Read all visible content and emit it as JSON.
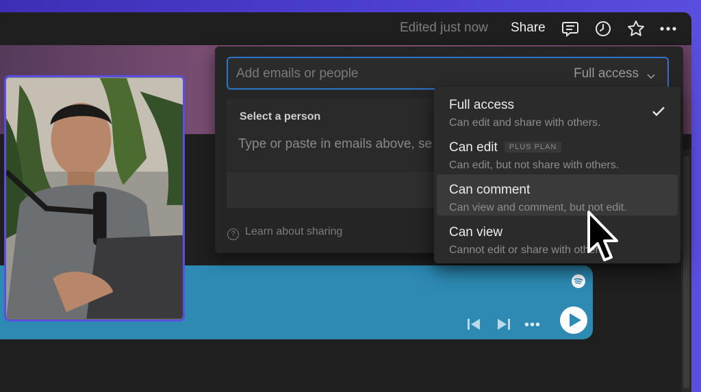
{
  "topbar": {
    "edited": "Edited just now",
    "share": "Share",
    "icons": [
      "comment-icon",
      "clock-icon",
      "star-icon",
      "more-icon"
    ]
  },
  "share_panel": {
    "email_placeholder": "Add emails or people",
    "access_value": "Full access",
    "select_title": "Select a person",
    "select_hint": "Type or paste in emails above, se",
    "learn": "Learn about sharing"
  },
  "access_menu": {
    "options": [
      {
        "title": "Full access",
        "desc": "Can edit and share with others.",
        "selected": true
      },
      {
        "title": "Can edit",
        "badge": "PLUS PLAN",
        "desc": "Can edit, but not share with others."
      },
      {
        "title": "Can comment",
        "desc": "Can view and comment, but not edit.",
        "hovered": true
      },
      {
        "title": "Can view",
        "desc": "Cannot edit or share with others."
      }
    ]
  },
  "spotify": {
    "icons": [
      "spotify-icon",
      "previous-icon",
      "next-icon",
      "more-icon",
      "play-icon"
    ],
    "more": "•••"
  },
  "colors": {
    "app_bg": "#1f1f1f",
    "accent_blue": "#2d75c9",
    "spotify_bg": "#2c8ab3",
    "frame_purple": "#4c3fd0"
  }
}
